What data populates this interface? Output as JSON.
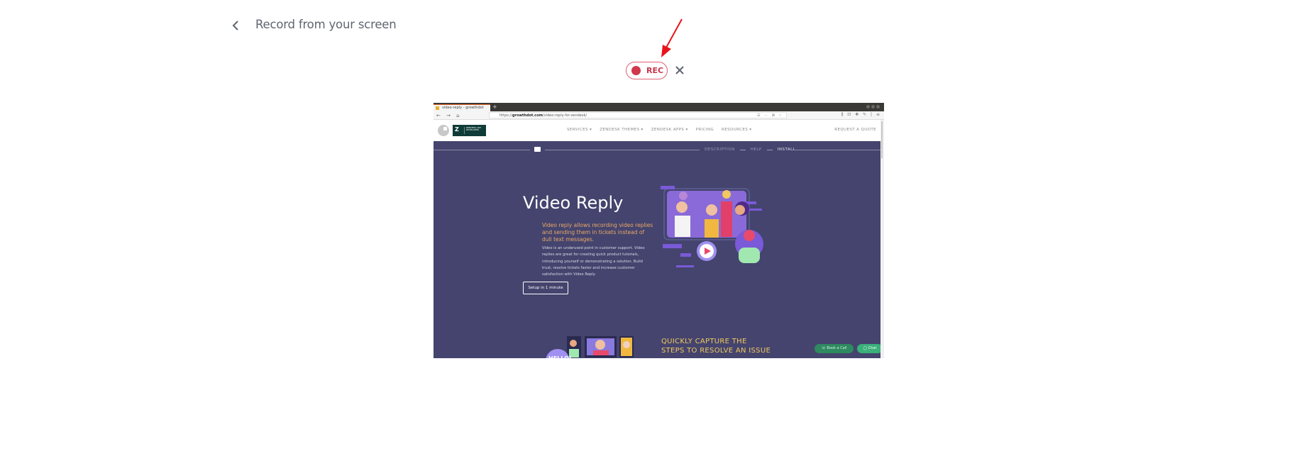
{
  "header": {
    "back_icon": "chevron-left-icon",
    "title": "Record from your screen"
  },
  "recording": {
    "rec_label": "REC",
    "rec_color": "#d0384c",
    "close_icon": "close-icon",
    "annotation": "red-arrow-pointing-to-rec"
  },
  "preview": {
    "browser": {
      "tab_title": "video-reply - growthdot",
      "tab_close": "×",
      "new_tab": "+",
      "nav_icons": "← → ⌂",
      "url_prefix": "https://",
      "url_domain": "growthdot.com",
      "url_path": "/video-reply-for-zendesk/",
      "url_inner_right": "☰ ⋯ ⊠ ☆",
      "toolbar_right": "⫼ ⊡ ✚ ✎ | ≡"
    },
    "site": {
      "brand_colors": {
        "header_bg": "#ffffff",
        "hero_bg": "#44446e",
        "accent_orange": "#eaa868",
        "accent_yellow": "#f0c860",
        "green": "#2e8a60"
      },
      "logo_text": "Z",
      "logo_badge": "ZENDESK APP DEVELOPER",
      "nav": [
        "SERVICES ▾",
        "ZENDESK THEMES ▾",
        "ZENDESK APPS ▾",
        "PRICING",
        "RESOURCES ▾"
      ],
      "quote": "REQUEST A QUOTE",
      "subnav": [
        "DESCRIPTION",
        "HELP",
        "INSTALL"
      ],
      "hero": {
        "title": "Video Reply",
        "lead": "Video reply allows recording video replies and sending them in tickets instead of dull text messages.",
        "body": "Video is an underused point in customer support. Video replies are great for creating quick product tutorials, introducing yourself or demonstrating a solution. Build trust, resolve tickets faster and increase customer satisfaction with Video Reply.",
        "cta": "Setup in 1 minute"
      },
      "section2": {
        "title_line1": "QUICKLY CAPTURE THE",
        "title_line2": "STEPS TO RESOLVE AN ISSUE",
        "hello": "HELLO!"
      },
      "floating": {
        "book_call": "☏ Book a Call",
        "chat": "◯ Chat"
      }
    }
  }
}
